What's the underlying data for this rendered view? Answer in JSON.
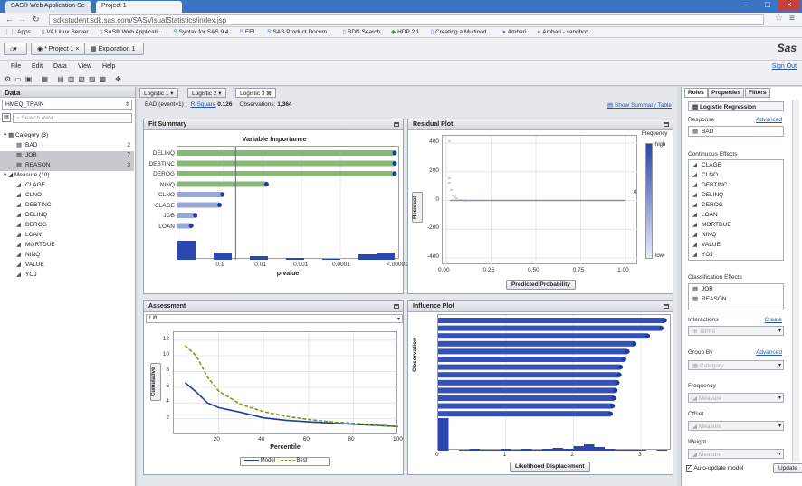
{
  "browser": {
    "tabs": [
      "SAS® Web Application Se",
      "Project 1"
    ],
    "url": "sdkstudent.sdk.sas.com/SASVisualStatistics/index.jsp",
    "bookmarks": [
      "Apps",
      "VA Linux Server",
      "SAS® Web Applicati...",
      "Syntax for SAS 9.4",
      "EEL",
      "SAS Product Docum...",
      "BDN Search",
      "HDP 2.1",
      "Creating a Multinod...",
      "Ambari",
      "Ambari - sandbox"
    ]
  },
  "app": {
    "project_tab": "* Project 1",
    "exploration_tab": "Exploration 1",
    "logo": "Sas",
    "sign_out": "Sign Out",
    "menus": [
      "File",
      "Edit",
      "Data",
      "View",
      "Help"
    ]
  },
  "data_pane": {
    "title": "Data",
    "dataset": "HMEQ_TRAIN",
    "search_placeholder": "Search data",
    "category_header": "Category (3)",
    "categories": [
      {
        "name": "BAD",
        "count": "2"
      },
      {
        "name": "JOB",
        "count": "7"
      },
      {
        "name": "REASON",
        "count": "3"
      }
    ],
    "measure_header": "Measure (10)",
    "measures": [
      "CLAGE",
      "CLNO",
      "DEBTINC",
      "DELINQ",
      "DEROG",
      "LOAN",
      "MORTDUE",
      "NINQ",
      "VALUE",
      "YOJ"
    ]
  },
  "model_tabs": [
    "Logistic 1",
    "Logistic 2",
    "Logistic 3"
  ],
  "summary": {
    "response": "BAD (event=1)",
    "rsq_label": "R-Square",
    "rsq": "0.126",
    "obs_label": "Observations:",
    "obs": "1,364",
    "show_table": "Show Summary Table"
  },
  "fit_summary": {
    "title": "Fit Summary",
    "chart_title": "Variable Importance",
    "xlabel": "p-value",
    "variables": [
      "DELINQ",
      "DEBTINC",
      "DEROG",
      "NINQ",
      "CLNO",
      "CLAGE",
      "JOB",
      "LOAN"
    ],
    "ticks": [
      "0.1",
      "0.01",
      "0.001",
      "0.0001",
      "<.00001"
    ]
  },
  "residual": {
    "title": "Residual Plot",
    "ylabel": "Residual",
    "xlabel": "Predicted Probability",
    "legend": "Frequency",
    "high": "high",
    "low": "low",
    "zero_label": "0",
    "yticks": [
      "400",
      "200",
      "0",
      "-200",
      "-400"
    ],
    "xticks": [
      "0.00",
      "0.25",
      "0.50",
      "0.75",
      "1.00"
    ]
  },
  "assessment": {
    "title": "Assessment",
    "select": "Lift",
    "ylabel": "Cumulative",
    "xlabel": "Percentile",
    "yticks": [
      "12",
      "10",
      "8",
      "6",
      "4",
      "2"
    ],
    "xticks": [
      "20",
      "40",
      "60",
      "80",
      "100"
    ],
    "legend_model": "Model",
    "legend_best": "Best"
  },
  "influence": {
    "title": "Influence Plot",
    "ylabel": "Observation",
    "xlabel": "Likelihood Displacement",
    "xticks": [
      "0",
      "1",
      "2",
      "3"
    ]
  },
  "right_pane": {
    "tabs": [
      "Roles",
      "Properties",
      "Filters"
    ],
    "model_type": "Logistic Regression",
    "response_label": "Response",
    "advanced": "Advanced",
    "response_value": "BAD",
    "continuous_label": "Continuous Effects",
    "continuous": [
      "CLAGE",
      "CLNO",
      "DEBTINC",
      "DELINQ",
      "DEROG",
      "LOAN",
      "MORTDUE",
      "NINQ",
      "VALUE",
      "YOJ"
    ],
    "class_label": "Classification Effects",
    "class_effects": [
      "JOB",
      "REASON"
    ],
    "interactions_label": "Interactions",
    "create": "Create",
    "interactions_placeholder": "Terms",
    "groupby_label": "Group By",
    "groupby_placeholder": "Category",
    "frequency_label": "Frequency",
    "frequency_placeholder": "Measure",
    "offset_label": "Offset",
    "offset_placeholder": "Measure",
    "weight_label": "Weight",
    "weight_placeholder": "Measure",
    "auto_update": "Auto-update model",
    "update": "Update"
  },
  "chart_data": [
    {
      "type": "bar",
      "title": "Variable Importance",
      "xlabel": "p-value",
      "categories": [
        "DELINQ",
        "DEBTINC",
        "DEROG",
        "NINQ",
        "CLNO",
        "CLAGE",
        "JOB",
        "LOAN"
      ],
      "values": [
        1e-06,
        1e-06,
        2e-06,
        0.008,
        0.11,
        0.13,
        0.55,
        0.7
      ]
    },
    {
      "type": "line",
      "title": "Assessment",
      "xlabel": "Percentile",
      "ylabel": "Cumulative",
      "ylim": [
        0,
        13
      ],
      "xlim": [
        0,
        100
      ],
      "x": [
        5,
        10,
        15,
        20,
        30,
        40,
        50,
        60,
        70,
        80,
        90,
        100
      ],
      "series": [
        {
          "name": "Model",
          "values": [
            6.6,
            5.4,
            4.0,
            3.4,
            2.8,
            2.1,
            1.8,
            1.6,
            1.45,
            1.3,
            1.15,
            1.0
          ]
        },
        {
          "name": "Best",
          "values": [
            11.3,
            10.0,
            7.3,
            5.5,
            3.8,
            2.9,
            2.3,
            1.9,
            1.6,
            1.4,
            1.2,
            1.0
          ]
        }
      ]
    },
    {
      "type": "bar",
      "title": "Influence Plot",
      "xlabel": "Likelihood Displacement",
      "xlim": [
        0,
        3.4
      ],
      "values": [
        3.35,
        3.3,
        3.1,
        2.9,
        2.8,
        2.75,
        2.7,
        2.68,
        2.65,
        2.62,
        2.6,
        2.58,
        2.55
      ]
    }
  ]
}
